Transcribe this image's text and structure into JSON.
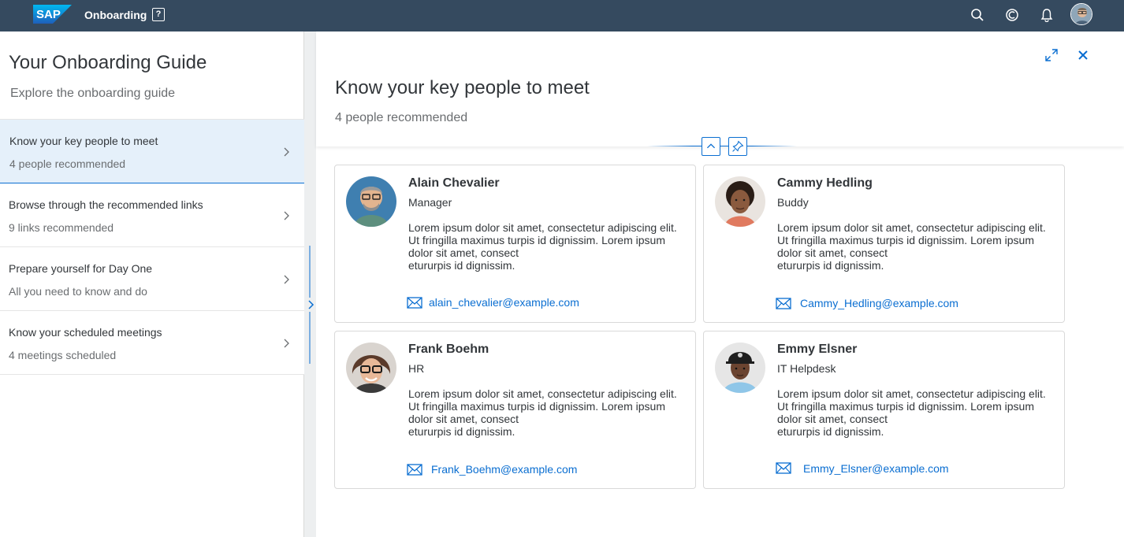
{
  "shell": {
    "logo_text": "SAP",
    "app_title": "Onboarding",
    "icons": [
      "help-icon",
      "search-icon",
      "copilot-icon",
      "notification-bell-icon",
      "user-avatar"
    ]
  },
  "master": {
    "title": "Your Onboarding Guide",
    "subtitle": "Explore the onboarding guide",
    "items": [
      {
        "title": "Know your key people to meet",
        "subtitle": "4 people recommended",
        "selected": true
      },
      {
        "title": "Browse through the recommended links",
        "subtitle": "9 links recommended"
      },
      {
        "title": "Prepare yourself for Day One",
        "subtitle": "All you need to know and do"
      },
      {
        "title": "Know your scheduled meetings",
        "subtitle": "4 meetings scheduled"
      }
    ]
  },
  "detail": {
    "title": "Know your key people to meet",
    "subtitle": "4 people recommended",
    "actions": [
      "fullscreen-icon",
      "close-icon"
    ],
    "cards": [
      {
        "name": "Alain Chevalier",
        "role": "Manager",
        "description": "Lorem ipsum dolor sit amet, consectetur adipiscing elit. Ut fringilla maximus turpis id dignissim. Lorem ipsum dolor sit amet, consect\netururpis id dignissim.",
        "email": "alain_chevalier@example.com"
      },
      {
        "name": "Cammy Hedling",
        "role": "Buddy",
        "description": "Lorem ipsum dolor sit amet, consectetur adipiscing elit. Ut fringilla maximus turpis id dignissim. Lorem ipsum dolor sit amet, consect\netururpis id dignissim.",
        "email": "Cammy_Hedling@example.com"
      },
      {
        "name": "Frank Boehm",
        "role": "HR",
        "description": "Lorem ipsum dolor sit amet, consectetur adipiscing elit. Ut fringilla maximus turpis id dignissim. Lorem ipsum dolor sit amet, consect\netururpis id dignissim.",
        "email": "Frank_Boehm@example.com"
      },
      {
        "name": "Emmy Elsner",
        "role": "IT Helpdesk",
        "description": "Lorem ipsum dolor sit amet, consectetur adipiscing elit. Ut fringilla maximus turpis id dignissim. Lorem ipsum dolor sit amet, consect\netururpis id dignissim.",
        "email": "Emmy_Elsner@example.com"
      }
    ]
  },
  "colors": {
    "shell_bg": "#354a5f",
    "accent": "#0a6ed1",
    "selected_bg": "#e5f0fa",
    "text": "#32363a",
    "muted_text": "#6a6d70"
  }
}
